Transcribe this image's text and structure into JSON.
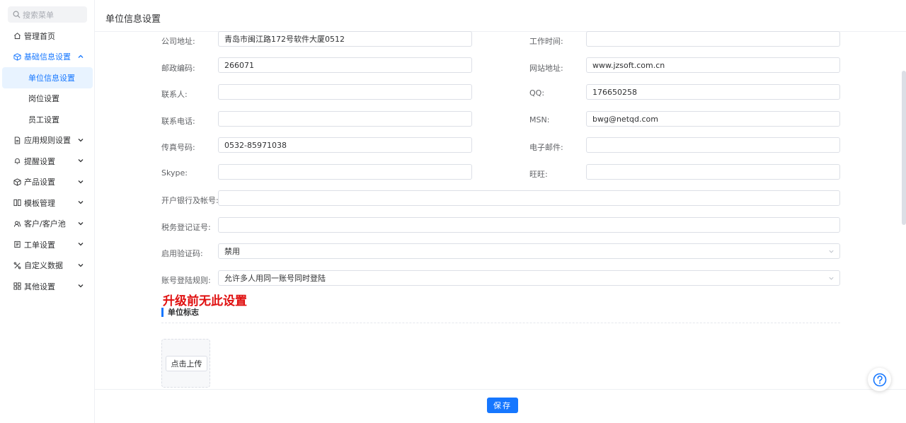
{
  "sidebar": {
    "search_placeholder": "搜索菜单",
    "items": [
      {
        "label": "管理首页",
        "icon": "home-icon"
      },
      {
        "label": "基础信息设置",
        "icon": "cube-icon",
        "expanded": true,
        "children": [
          {
            "label": "单位信息设置",
            "selected": true
          },
          {
            "label": "岗位设置"
          },
          {
            "label": "员工设置"
          }
        ]
      },
      {
        "label": "应用规则设置",
        "icon": "document-icon"
      },
      {
        "label": "提醒设置",
        "icon": "bell-icon"
      },
      {
        "label": "产品设置",
        "icon": "box-icon"
      },
      {
        "label": "模板管理",
        "icon": "template-icon"
      },
      {
        "label": "客户/客户池",
        "icon": "contacts-icon"
      },
      {
        "label": "工单设置",
        "icon": "ticket-icon"
      },
      {
        "label": "自定义数据",
        "icon": "custom-data-icon"
      },
      {
        "label": "其他设置",
        "icon": "grid-icon"
      }
    ]
  },
  "header": {
    "title": "单位信息设置"
  },
  "form": {
    "company_address": {
      "label": "公司地址:",
      "value": "青岛市闽江路172号软件大厦0512"
    },
    "work_time": {
      "label": "工作时间:",
      "value": ""
    },
    "postal_code": {
      "label": "邮政编码:",
      "value": "266071"
    },
    "website": {
      "label": "网站地址:",
      "value": "www.jzsoft.com.cn"
    },
    "contact": {
      "label": "联系人:",
      "value": ""
    },
    "qq": {
      "label": "QQ:",
      "value": "176650258"
    },
    "phone": {
      "label": "联系电话:",
      "value": ""
    },
    "msn": {
      "label": "MSN:",
      "value": "bwg@netqd.com"
    },
    "fax": {
      "label": "传真号码:",
      "value": "0532-85971038"
    },
    "email": {
      "label": "电子邮件:",
      "value": ""
    },
    "skype": {
      "label": "Skype:",
      "value": ""
    },
    "wangwang": {
      "label": "旺旺:",
      "value": ""
    },
    "bank": {
      "label": "开户银行及帐号:",
      "value": ""
    },
    "tax": {
      "label": "税务登记证号:",
      "value": ""
    },
    "captcha": {
      "label": "启用验证码:",
      "value": "禁用"
    },
    "login_rule": {
      "label": "账号登陆规则:",
      "value": "允许多人用同一账号同时登陆"
    }
  },
  "note": "升级前无此设置",
  "logo_section": {
    "title": "单位标志",
    "upload_label": "点击上传"
  },
  "footer": {
    "save_label": "保存"
  },
  "colors": {
    "accent": "#1677ff",
    "note": "#e01010"
  }
}
